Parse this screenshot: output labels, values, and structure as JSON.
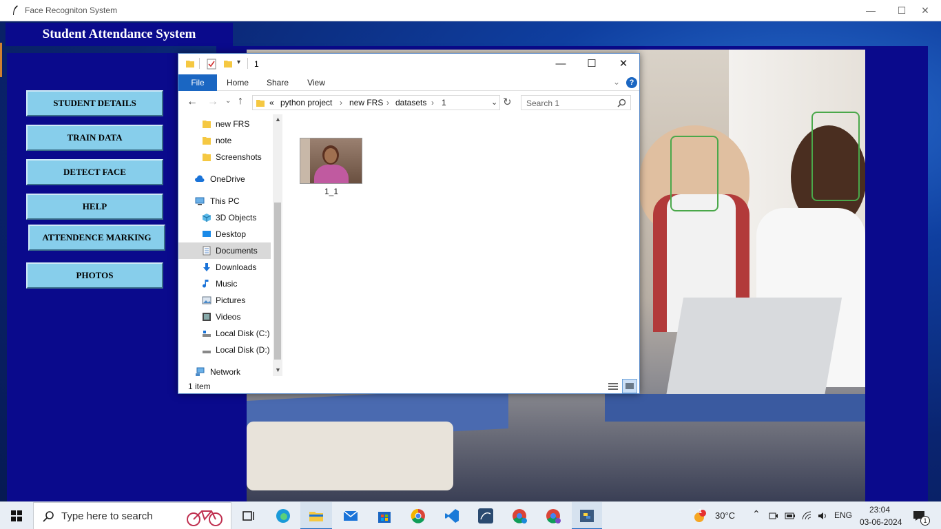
{
  "app": {
    "title": "Face Recogniton System",
    "header": "Student Attendance System",
    "menu": [
      "STUDENT DETAILS",
      "TRAIN DATA",
      "DETECT FACE",
      "HELP",
      "ATTENDENCE MARKING",
      "PHOTOS"
    ]
  },
  "explorer": {
    "title": "1",
    "ribbon_tabs": [
      "File",
      "Home",
      "Share",
      "View"
    ],
    "breadcrumb": {
      "overflow": "«",
      "segments": [
        "python project",
        "new FRS",
        "datasets",
        "1"
      ]
    },
    "search_placeholder": "Search 1",
    "nav_items": [
      {
        "label": "new FRS",
        "icon": "folder-icon"
      },
      {
        "label": "note",
        "icon": "folder-icon"
      },
      {
        "label": "Screenshots",
        "icon": "folder-icon"
      },
      {
        "label": "OneDrive",
        "icon": "cloud-icon"
      },
      {
        "label": "This PC",
        "icon": "computer-icon"
      },
      {
        "label": "3D Objects",
        "icon": "cube-icon"
      },
      {
        "label": "Desktop",
        "icon": "desktop-icon"
      },
      {
        "label": "Documents",
        "icon": "documents-icon"
      },
      {
        "label": "Downloads",
        "icon": "download-icon"
      },
      {
        "label": "Music",
        "icon": "music-icon"
      },
      {
        "label": "Pictures",
        "icon": "pictures-icon"
      },
      {
        "label": "Videos",
        "icon": "video-icon"
      },
      {
        "label": "Local Disk (C:)",
        "icon": "disk-icon"
      },
      {
        "label": "Local Disk (D:)",
        "icon": "disk-icon"
      },
      {
        "label": "Network",
        "icon": "network-icon"
      }
    ],
    "selected_nav": "Documents",
    "files": [
      {
        "name": "1_1",
        "type": "image"
      }
    ],
    "status": "1 item"
  },
  "taskbar": {
    "search_placeholder": "Type here to search",
    "weather": "30°C",
    "weather_badge": "1",
    "language": "ENG",
    "time": "23:04",
    "date": "03-06-2024",
    "notification_count": "1"
  },
  "colors": {
    "app_panel": "#0a0a8c",
    "menu_button": "#87ceeb",
    "explorer_accent": "#1a66c2"
  }
}
